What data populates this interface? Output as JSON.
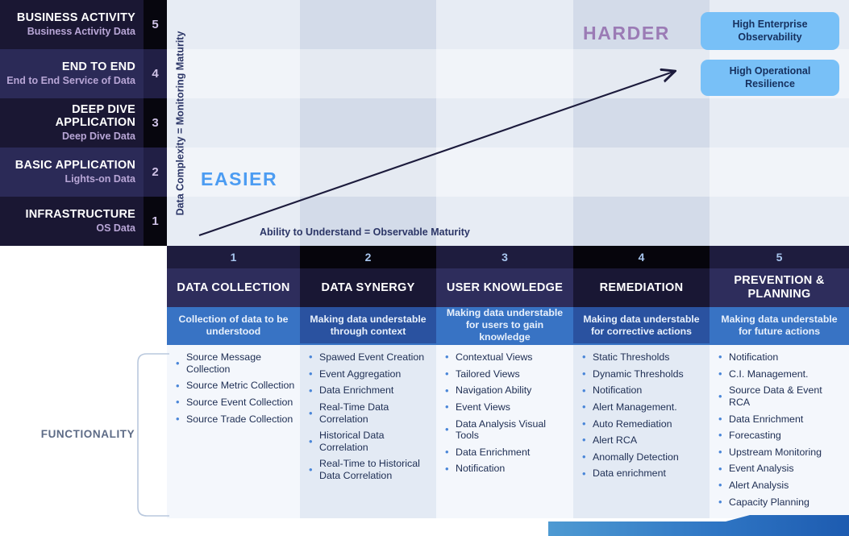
{
  "axes": {
    "y_label": "Data Complexity = Monitoring Maturity",
    "x_label": "Ability to Understand = Observable Maturity",
    "easier": "EASIER",
    "harder": "HARDER"
  },
  "maturity_levels": [
    {
      "num": "5",
      "title": "BUSINESS ACTIVITY",
      "sub": "Business Activity Data"
    },
    {
      "num": "4",
      "title": "END TO END",
      "sub": "End to End Service of Data"
    },
    {
      "num": "3",
      "title": "DEEP DIVE APPLICATION",
      "sub": "Deep Dive Data"
    },
    {
      "num": "2",
      "title": "BASIC APPLICATION",
      "sub": "Lights-on Data"
    },
    {
      "num": "1",
      "title": "INFRASTRUCTURE",
      "sub": "OS Data"
    }
  ],
  "outcome_pills": [
    {
      "label": "High Enterprise Observability"
    },
    {
      "label": "High Operational Resilience"
    }
  ],
  "functionality_label": "FUNCTIONALITY",
  "columns": [
    {
      "num": "1",
      "name": "DATA COLLECTION",
      "desc": "Collection of data to be understood",
      "items": [
        "Source Message Collection",
        "Source Metric Collection",
        "Source Event Collection",
        "Source Trade Collection"
      ]
    },
    {
      "num": "2",
      "name": "DATA SYNERGY",
      "desc": "Making data understable through context",
      "items": [
        "Spawed Event Creation",
        "Event Aggregation",
        "Data Enrichment",
        "Real-Time Data Correlation",
        "Historical Data Correlation",
        "Real-Time to Historical Data Correlation"
      ]
    },
    {
      "num": "3",
      "name": "USER KNOWLEDGE",
      "desc": "Making data understable for users to gain knowledge",
      "items": [
        "Contextual Views",
        "Tailored Views",
        "Navigation Ability",
        "Event Views",
        "Data Analysis Visual Tools",
        "Data Enrichment",
        "Notification"
      ]
    },
    {
      "num": "4",
      "name": "REMEDIATION",
      "desc": "Making data understable for corrective actions",
      "items": [
        "Static Thresholds",
        "Dynamic Thresholds",
        "Notification",
        "Alert Management.",
        "Auto Remediation",
        "Alert RCA",
        "Anomally Detection",
        "Data enrichment"
      ]
    },
    {
      "num": "5",
      "name": "PREVENTION & PLANNING",
      "desc": "Making data understable for future actions",
      "items": [
        "Notification",
        "C.I. Management.",
        "Source Data & Event RCA",
        "Data Enrichment",
        "Forecasting",
        "Upstream Monitoring",
        "Event Analysis",
        "Alert Analysis",
        "Capacity Planning"
      ]
    }
  ],
  "colors": {
    "pill": "#78c0f7",
    "easier": "#4c9cf2",
    "harder": "#9b7bb5",
    "band_desc": "#3873c4",
    "bullet": "#4a86d8",
    "arrow": "#1c1b3c"
  }
}
